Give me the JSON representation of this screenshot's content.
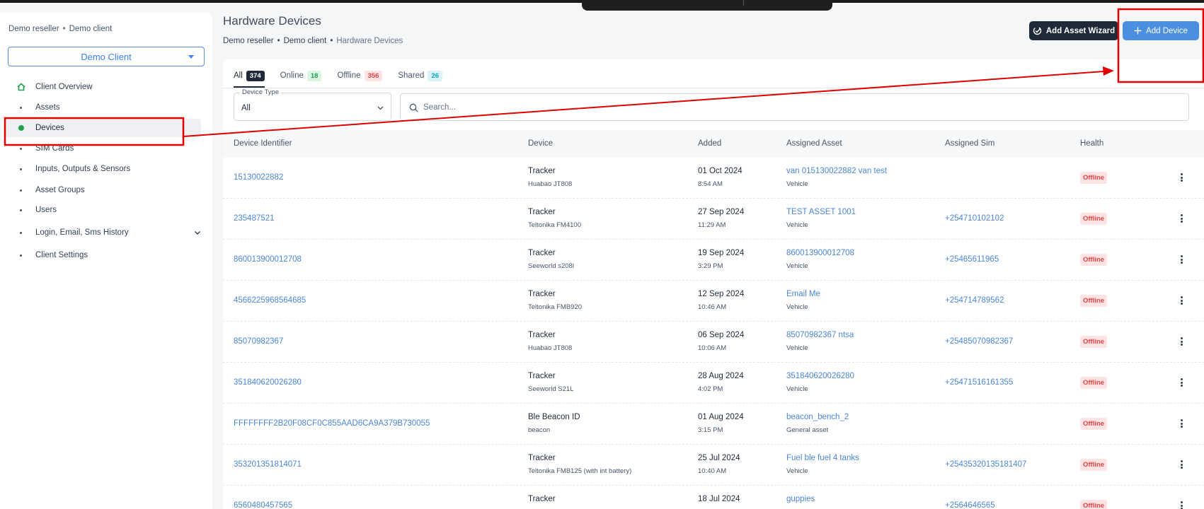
{
  "sidebar": {
    "breadcrumb": [
      "Demo reseller",
      "Demo client"
    ],
    "client_select": "Demo Client",
    "nav": [
      {
        "label": "Client Overview",
        "icon": "home-icon"
      },
      {
        "label": "Assets"
      },
      {
        "label": "Devices",
        "active": true
      },
      {
        "label": "SIM Cards"
      },
      {
        "label": "Inputs, Outputs & Sensors"
      },
      {
        "label": "Asset Groups"
      },
      {
        "label": "Users"
      },
      {
        "label": "Login, Email, Sms History",
        "expandable": true
      },
      {
        "label": "Client Settings"
      }
    ]
  },
  "header": {
    "title": "Hardware Devices",
    "breadcrumb": [
      "Demo reseller",
      "Demo client",
      "Hardware Devices"
    ],
    "wizard_label": "Add Asset Wizard",
    "add_label": "Add Device"
  },
  "tabs": [
    {
      "label": "All",
      "count": "374",
      "style": "dark"
    },
    {
      "label": "Online",
      "count": "18",
      "style": "green"
    },
    {
      "label": "Offline",
      "count": "356",
      "style": "red"
    },
    {
      "label": "Shared",
      "count": "26",
      "style": "cyan"
    }
  ],
  "filters": {
    "device_type_label": "Device Type",
    "device_type_value": "All",
    "search_placeholder": "Search..."
  },
  "table": {
    "columns": [
      "Device Identifier",
      "Device",
      "Added",
      "Assigned Asset",
      "Assigned Sim",
      "Health"
    ],
    "rows": [
      {
        "id": "15130022882",
        "device": "Tracker",
        "model": "Huabao JT808",
        "date": "01 Oct 2024",
        "time": "8:54 AM",
        "asset": "van 015130022882 van test",
        "asset_type": "Vehicle",
        "sim": "",
        "health": "Offline"
      },
      {
        "id": "235487521",
        "device": "Tracker",
        "model": "Teltonika FM4100",
        "date": "27 Sep 2024",
        "time": "11:29 AM",
        "asset": "TEST ASSET 1001",
        "asset_type": "Vehicle",
        "sim": "+254710102102",
        "health": "Offline"
      },
      {
        "id": "860013900012708",
        "device": "Tracker",
        "model": "Seeworld s208l",
        "date": "19 Sep 2024",
        "time": "3:29 PM",
        "asset": "860013900012708",
        "asset_type": "Vehicle",
        "sim": "+25465611965",
        "health": "Offline"
      },
      {
        "id": "4566225968564685",
        "device": "Tracker",
        "model": "Teltonika FMB920",
        "date": "12 Sep 2024",
        "time": "10:46 AM",
        "asset": "Email Me",
        "asset_type": "Vehicle",
        "sim": "+254714789562",
        "health": "Offline"
      },
      {
        "id": "85070982367",
        "device": "Tracker",
        "model": "Huabao JT808",
        "date": "06 Sep 2024",
        "time": "10:06 AM",
        "asset": "85070982367 ntsa",
        "asset_type": "Vehicle",
        "sim": "+25485070982367",
        "health": "Offline"
      },
      {
        "id": "351840620026280",
        "device": "Tracker",
        "model": "Seeworld S21L",
        "date": "28 Aug 2024",
        "time": "4:02 PM",
        "asset": "351840620026280",
        "asset_type": "Vehicle",
        "sim": "+25471516161355",
        "health": "Offline"
      },
      {
        "id": "FFFFFFFF2B20F08CF0C855AAD6CA9A379B730055",
        "device": "Ble Beacon ID",
        "model": "beacon",
        "date": "01 Aug 2024",
        "time": "3:15 PM",
        "asset": "beacon_bench_2",
        "asset_type": "General asset",
        "sim": "",
        "health": "Offline"
      },
      {
        "id": "353201351814071",
        "device": "Tracker",
        "model": "Teltonika FMB125 (with int battery)",
        "date": "25 Jul 2024",
        "time": "10:40 AM",
        "asset": "Fuel ble fuel 4 tanks",
        "asset_type": "Vehicle",
        "sim": "+25435320135181407",
        "health": "Offline"
      },
      {
        "id": "6560480457565",
        "device": "Tracker",
        "model": "",
        "date": "18 Jul 2024",
        "time": "",
        "asset": "guppies",
        "asset_type": "",
        "sim": "+2564646565",
        "health": "Offline"
      }
    ]
  },
  "colors": {
    "accent": "#4a8fe0",
    "active_dot": "#22a04b",
    "offline": "#dc4545",
    "annotation": "#e00000"
  }
}
